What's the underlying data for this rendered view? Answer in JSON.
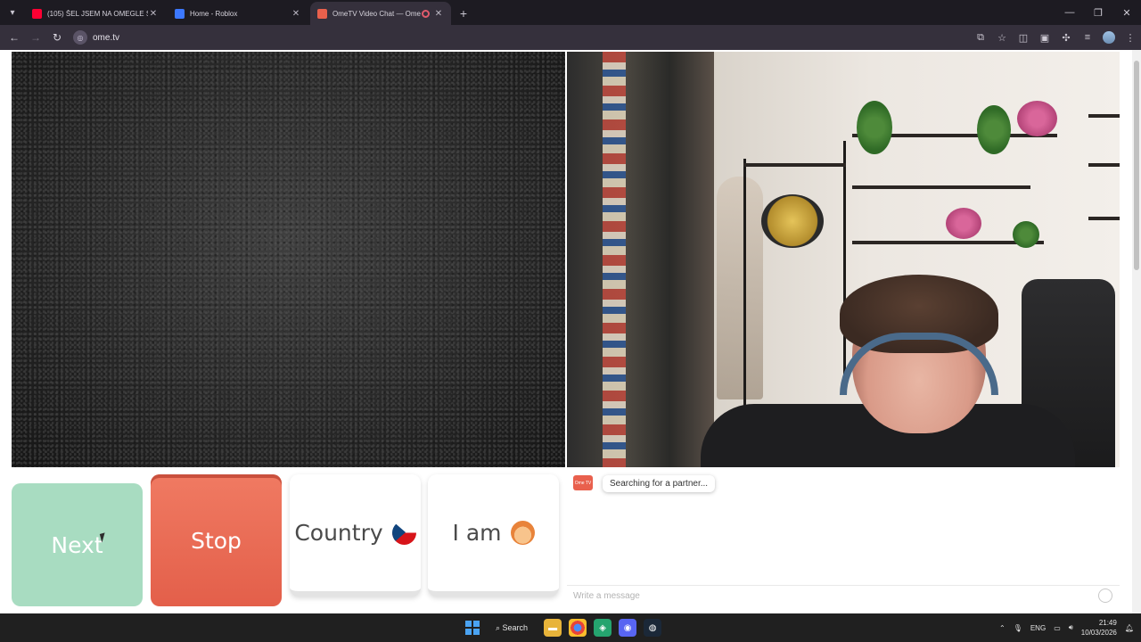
{
  "browser": {
    "tabs": [
      {
        "title": "(105) ŠEL JSEM NA OMEGLE S M",
        "favicon_color": "#ff0033",
        "active": false
      },
      {
        "title": "Home - Roblox",
        "favicon_color": "#3c78ff",
        "active": false
      },
      {
        "title": "OmeTV Video Chat — Ome",
        "favicon_color": "#e8604c",
        "active": true
      }
    ],
    "url": "ome.tv"
  },
  "buttons": {
    "next": "Next",
    "stop": "Stop",
    "country": "Country",
    "iam": "I am"
  },
  "chat": {
    "logo_text": "Ome TV",
    "status": "Searching for a partner...",
    "placeholder": "Write a message"
  },
  "taskbar": {
    "search_label": "Search",
    "language": "ENG",
    "time": "21:49",
    "date": "10/03/2026"
  },
  "colors": {
    "next": "#a8dcc1",
    "stop": "#e8664f",
    "accent": "#e9604d"
  }
}
